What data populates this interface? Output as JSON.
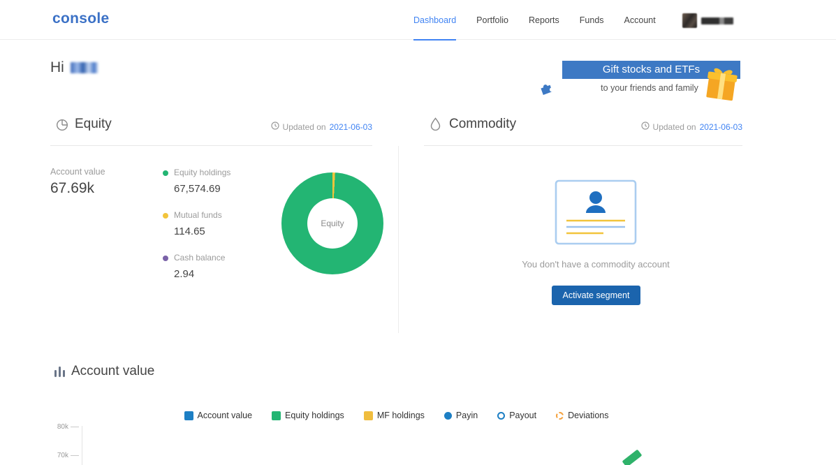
{
  "header": {
    "logo": "console",
    "nav": [
      {
        "label": "Dashboard",
        "active": true
      },
      {
        "label": "Portfolio",
        "active": false
      },
      {
        "label": "Reports",
        "active": false
      },
      {
        "label": "Funds",
        "active": false
      },
      {
        "label": "Account",
        "active": false
      }
    ]
  },
  "greeting": {
    "text": "Hi"
  },
  "banner": {
    "title": "Gift stocks and ETFs",
    "subtitle": "to your friends and family"
  },
  "equity": {
    "title": "Equity",
    "updated_label": "Updated on",
    "updated_date": "2021-06-03",
    "account_value_label": "Account value",
    "account_value": "67.69k",
    "legend": [
      {
        "label": "Equity holdings",
        "value": "67,574.69",
        "color": "#23b573"
      },
      {
        "label": "Mutual funds",
        "value": "114.65",
        "color": "#f2c43c"
      },
      {
        "label": "Cash balance",
        "value": "2.94",
        "color": "#7a62a8"
      }
    ],
    "donut_center_label": "Equity"
  },
  "commodity": {
    "title": "Commodity",
    "updated_label": "Updated on",
    "updated_date": "2021-06-03",
    "empty_text": "You don't have a commodity account",
    "button_label": "Activate segment"
  },
  "account_value_section": {
    "title": "Account value",
    "legend": [
      {
        "label": "Account value",
        "swatch": "square",
        "color": "#1d7fc4"
      },
      {
        "label": "Equity holdings",
        "swatch": "square",
        "color": "#23b573"
      },
      {
        "label": "MF holdings",
        "swatch": "square",
        "color": "#f0bd3e"
      },
      {
        "label": "Payin",
        "swatch": "circle-filled",
        "color": "#1d7fc4"
      },
      {
        "label": "Payout",
        "swatch": "circle-outline",
        "color": "#1d7fc4"
      },
      {
        "label": "Deviations",
        "swatch": "circle-dashed",
        "color": "#f5a13d"
      }
    ],
    "y_ticks": [
      "80k",
      "70k"
    ]
  },
  "colors": {
    "accent_blue": "#4184f3",
    "logo_blue": "#3b71c6",
    "banner_blue": "#3d79c4",
    "button_blue": "#1b64ad",
    "green": "#23b573",
    "yellow": "#f2c43c",
    "purple": "#7a62a8",
    "orange": "#f5a13d"
  }
}
